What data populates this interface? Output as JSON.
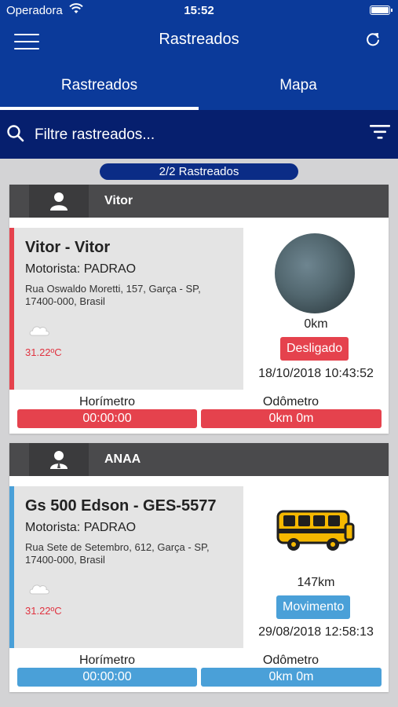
{
  "status_bar": {
    "carrier": "Operadora",
    "time": "15:52"
  },
  "header": {
    "title": "Rastreados"
  },
  "tabs": [
    {
      "label": "Rastreados",
      "active": true
    },
    {
      "label": "Mapa",
      "active": false
    }
  ],
  "search": {
    "placeholder": "Filtre rastreados..."
  },
  "count_label": "2/2 Rastreados",
  "colors": {
    "brand": "#0b3a9a",
    "off": "#e5424d",
    "moving": "#4aa0d8"
  },
  "cards": [
    {
      "group": "Vitor",
      "name": "Vitor - Vitor",
      "driver": "Motorista: PADRAO",
      "address": "Rua Oswaldo Moretti, 157, Garça - SP, 17400-000, Brasil",
      "temperature": "31.22ºC",
      "distance": "0km",
      "status": "Desligado",
      "timestamp": "18/10/2018 10:43:52",
      "hourmeter_label": "Horímetro",
      "hourmeter": "00:00:00",
      "odometer_label": "Odômetro",
      "odometer": "0km 0m"
    },
    {
      "group": "ANAA",
      "name": "Gs 500 Edson - GES-5577",
      "driver": "Motorista: PADRAO",
      "address": "Rua Sete de Setembro, 612, Garça - SP, 17400-000, Brasil",
      "temperature": "31.22ºC",
      "distance": "147km",
      "status": "Movimento",
      "timestamp": "29/08/2018 12:58:13",
      "hourmeter_label": "Horímetro",
      "hourmeter": "00:00:00",
      "odometer_label": "Odômetro",
      "odometer": "0km 0m"
    }
  ]
}
